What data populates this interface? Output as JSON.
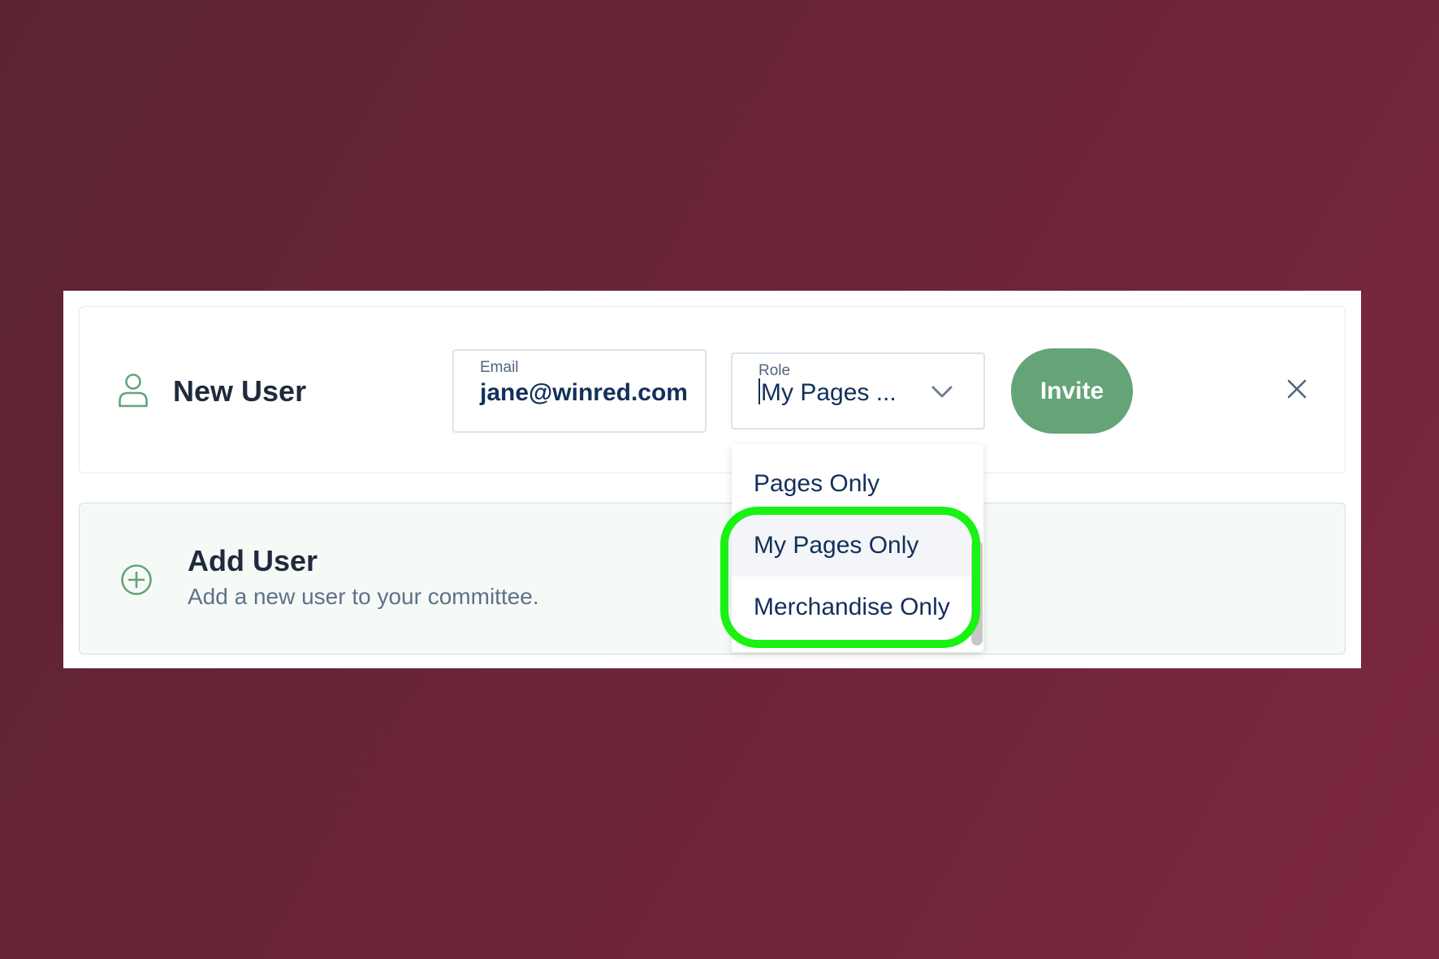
{
  "new_user_form": {
    "title": "New User",
    "email_label": "Email",
    "email_value": "jane@winred.com",
    "role_label": "Role",
    "role_value": "My Pages ...",
    "invite_label": "Invite",
    "close_icon": "close-icon",
    "user_icon": "user-icon",
    "chevron_icon": "chevron-down-icon"
  },
  "add_user": {
    "title": "Add User",
    "subtitle": "Add a new user to your committee.",
    "icon": "plus-circle-icon"
  },
  "role_dropdown": {
    "options": [
      "Pages Only",
      "My Pages Only",
      "Merchandise Only"
    ],
    "hovered_option": "My Pages Only"
  },
  "colors": {
    "background": "#6d2538",
    "accent_green": "#64a477",
    "text_dark": "#1f2b3c",
    "text_navy": "#12305a",
    "highlight_green": "#19f212"
  }
}
